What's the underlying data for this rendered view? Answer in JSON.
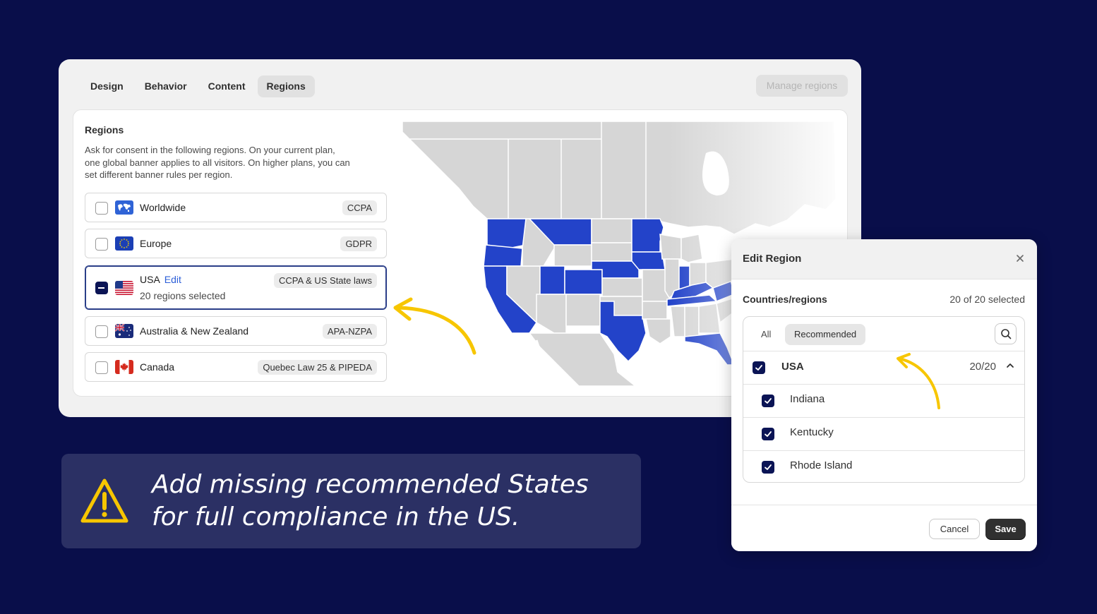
{
  "tabs": [
    {
      "label": "Design",
      "active": false
    },
    {
      "label": "Behavior",
      "active": false
    },
    {
      "label": "Content",
      "active": false
    },
    {
      "label": "Regions",
      "active": true
    }
  ],
  "header": {
    "manage_regions_label": "Manage regions"
  },
  "regions_card": {
    "title": "Regions",
    "description": "Ask for consent in the following regions. On your current plan, one global banner applies to all visitors. On higher plans, you can set different banner rules per region.",
    "rows": [
      {
        "name": "Worldwide",
        "badge": "CCPA",
        "checked": false,
        "flag": "world-flag"
      },
      {
        "name": "Europe",
        "badge": "GDPR",
        "checked": false,
        "flag": "eu-flag"
      },
      {
        "name": "USA",
        "edit_label": "Edit",
        "sub": "20 regions selected",
        "badge": "CCPA & US State laws",
        "checked": "partial",
        "flag": "us-flag"
      },
      {
        "name": "Australia & New Zealand",
        "badge": "APA-NZPA",
        "checked": false,
        "flag": "au-flag"
      },
      {
        "name": "Canada",
        "badge": "Quebec Law 25 & PIPEDA",
        "checked": false,
        "flag": "ca-flag"
      }
    ]
  },
  "map": {
    "highlight_color": "#2343c9",
    "base_color": "#d6d6d6"
  },
  "modal": {
    "title": "Edit Region",
    "section_label": "Countries/regions",
    "selected_count": "20 of 20 selected",
    "filter_all": "All",
    "filter_recommended": "Recommended",
    "group": {
      "name": "USA",
      "count": "20/20"
    },
    "items": [
      "Indiana",
      "Kentucky",
      "Rhode Island"
    ],
    "cancel_label": "Cancel",
    "save_label": "Save"
  },
  "banner": {
    "line1": "Add missing recommended States",
    "line2": "for full compliance in the US."
  },
  "colors": {
    "background": "#090e4a",
    "accent_arrow": "#f7c600",
    "checkbox": "#0b1455"
  }
}
